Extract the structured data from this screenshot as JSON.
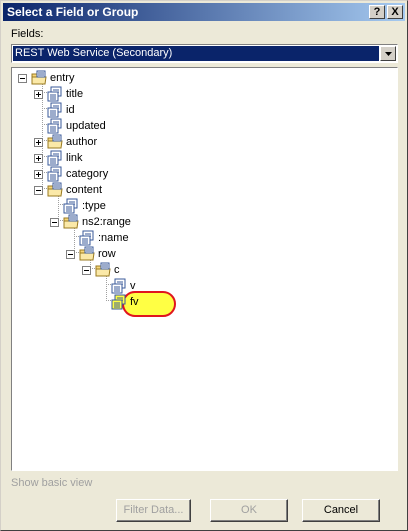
{
  "window": {
    "title": "Select a Field or Group",
    "help_label": "?",
    "close_label": "X"
  },
  "fields": {
    "label": "Fields:",
    "selected_source": "REST Web Service (Secondary)"
  },
  "tree": {
    "nodes": [
      {
        "label": "entry",
        "icon": "folder-group-icon",
        "expander": "minus"
      },
      {
        "label": "title",
        "icon": "field-icon",
        "expander": "plus"
      },
      {
        "label": "id",
        "icon": "field-icon",
        "expander": "none"
      },
      {
        "label": "updated",
        "icon": "field-icon",
        "expander": "none"
      },
      {
        "label": "author",
        "icon": "folder-group-icon",
        "expander": "plus"
      },
      {
        "label": "link",
        "icon": "field-icon",
        "expander": "plus"
      },
      {
        "label": "category",
        "icon": "field-icon",
        "expander": "plus"
      },
      {
        "label": "content",
        "icon": "folder-group-icon",
        "expander": "minus"
      },
      {
        "label": ":type",
        "icon": "field-icon",
        "expander": "none"
      },
      {
        "label": "ns2:range",
        "icon": "folder-group-icon",
        "expander": "minus"
      },
      {
        "label": ":name",
        "icon": "field-icon",
        "expander": "none"
      },
      {
        "label": "row",
        "icon": "folder-group-icon",
        "expander": "minus"
      },
      {
        "label": "c",
        "icon": "folder-group-icon",
        "expander": "minus"
      },
      {
        "label": "v",
        "icon": "field-icon",
        "expander": "none"
      },
      {
        "label": "fv",
        "icon": "field-icon",
        "expander": "none",
        "highlighted": true
      }
    ]
  },
  "show_basic_view": "Show basic view",
  "buttons": {
    "filter": "Filter Data...",
    "ok": "OK",
    "cancel": "Cancel"
  },
  "colors": {
    "title_bar": "#0a246a",
    "dialog_bg": "#ece9d8",
    "highlight_ring": "#e0161e",
    "highlight_fill": "#ffff44"
  }
}
